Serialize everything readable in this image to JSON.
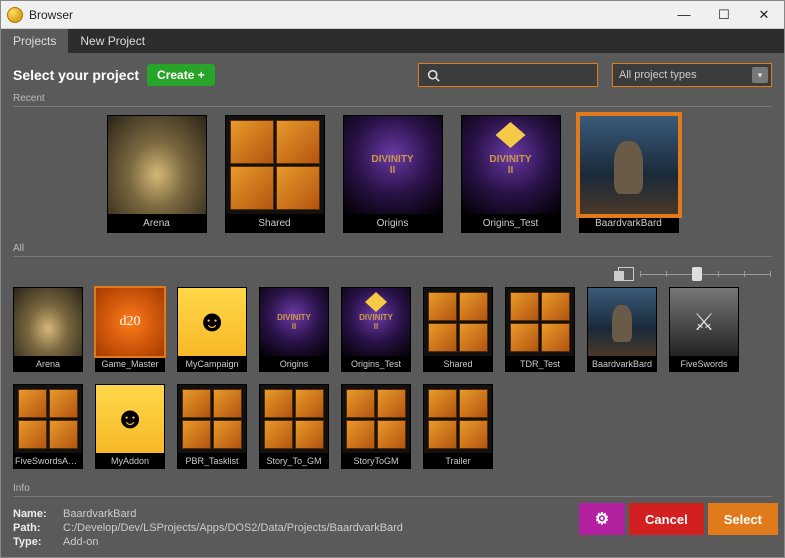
{
  "window": {
    "title": "Browser"
  },
  "titlebar_buttons": {
    "min": "—",
    "max": "☐",
    "close": "✕"
  },
  "menubar": {
    "projects": "Projects",
    "new_project": "New Project"
  },
  "header": {
    "title": "Select your project",
    "create_label": "Create +",
    "search_placeholder": "",
    "type_filter": "All project types"
  },
  "sections": {
    "recent": "Recent",
    "all": "All",
    "info": "Info"
  },
  "recent": [
    {
      "label": "Arena",
      "art": "hand"
    },
    {
      "label": "Shared",
      "art": "grid"
    },
    {
      "label": "Origins",
      "art": "div"
    },
    {
      "label": "Origins_Test",
      "art": "div",
      "sign": true
    },
    {
      "label": "BaardvarkBard",
      "art": "bard",
      "selected": true
    }
  ],
  "all": [
    {
      "label": "Arena",
      "art": "hand"
    },
    {
      "label": "Game_Master",
      "art": "dice",
      "hl": true
    },
    {
      "label": "MyCampaign",
      "art": "face"
    },
    {
      "label": "Origins",
      "art": "div"
    },
    {
      "label": "Origins_Test",
      "art": "div",
      "sign": true
    },
    {
      "label": "Shared",
      "art": "grid"
    },
    {
      "label": "TDR_Test",
      "art": "grid"
    },
    {
      "label": "BaardvarkBard",
      "art": "bard"
    },
    {
      "label": "FiveSwords",
      "art": "sword"
    },
    {
      "label": "FiveSwordsAndOneRing",
      "art": "grid"
    },
    {
      "label": "MyAddon",
      "art": "face"
    },
    {
      "label": "PBR_Tasklist",
      "art": "grid"
    },
    {
      "label": "Story_To_GM",
      "art": "grid"
    },
    {
      "label": "StoryToGM",
      "art": "grid"
    },
    {
      "label": "Trailer",
      "art": "grid"
    }
  ],
  "info": {
    "name_key": "Name:",
    "name_val": "BaardvarkBard",
    "path_key": "Path:",
    "path_val": "C:/Develop/Dev/LSProjects/Apps/DOS2/Data/Projects/BaardvarkBard",
    "type_key": "Type:",
    "type_val": "Add-on"
  },
  "footer": {
    "cancel": "Cancel",
    "select": "Select"
  },
  "zoom": {
    "value": 40
  }
}
